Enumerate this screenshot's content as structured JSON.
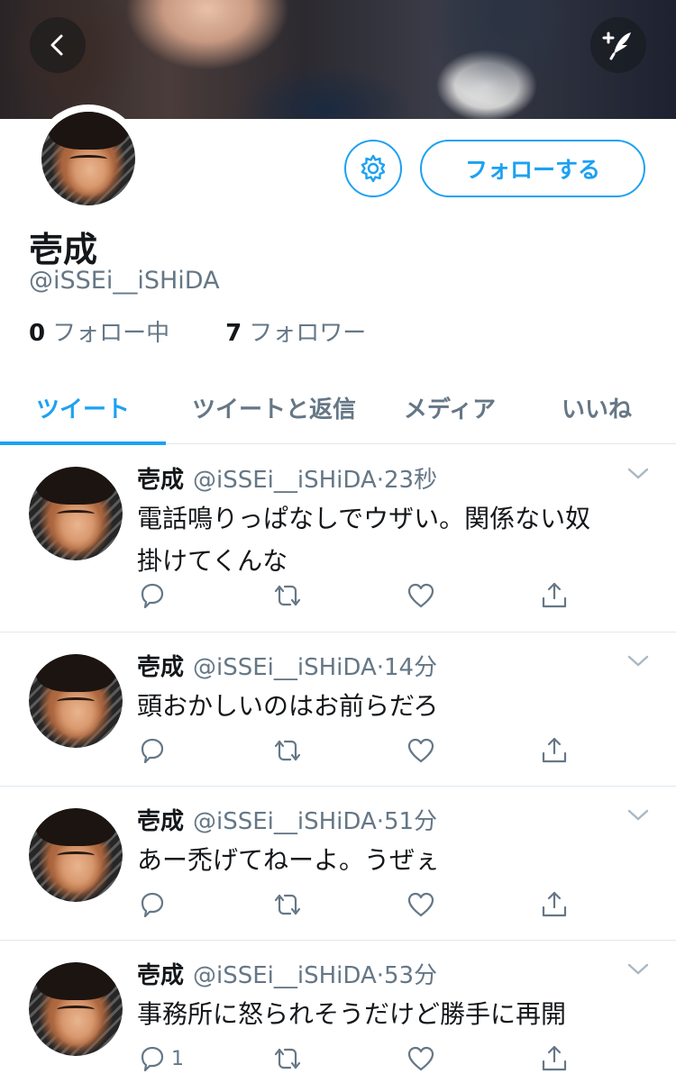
{
  "profile": {
    "display_name": "壱成",
    "handle": "@iSSEi__iSHiDA",
    "following_count": "0",
    "following_label": "フォロー中",
    "followers_count": "7",
    "followers_label": "フォロワー",
    "follow_button": "フォローする"
  },
  "tabs": [
    {
      "label": "ツイート",
      "active": true
    },
    {
      "label": "ツイートと返信",
      "active": false
    },
    {
      "label": "メディア",
      "active": false
    },
    {
      "label": "いいね",
      "active": false
    }
  ],
  "tweets": [
    {
      "name": "壱成",
      "handle": "@iSSEi__iSHiDA",
      "time": "23秒",
      "text_lines": [
        "電話鳴りっぱなしでウザい。関係ない奴",
        "掛けてくんな"
      ],
      "reply_count": ""
    },
    {
      "name": "壱成",
      "handle": "@iSSEi__iSHiDA",
      "time": "14分",
      "text_lines": [
        "頭おかしいのはお前らだろ"
      ],
      "reply_count": ""
    },
    {
      "name": "壱成",
      "handle": "@iSSEi__iSHiDA",
      "time": "51分",
      "text_lines": [
        "あー禿げてねーよ。うぜぇ"
      ],
      "reply_count": ""
    },
    {
      "name": "壱成",
      "handle": "@iSSEi__iSHiDA",
      "time": "53分",
      "text_lines": [
        "事務所に怒られそうだけど勝手に再開"
      ],
      "reply_count": "1"
    }
  ],
  "icons": {
    "back": "back-chevron-icon",
    "compose": "compose-tweet-icon",
    "settings": "gear-icon",
    "caret": "chevron-down-icon",
    "reply": "reply-bubble-icon",
    "retweet": "retweet-icon",
    "like": "heart-icon",
    "share": "share-icon"
  },
  "colors": {
    "accent": "#1da1f2",
    "secondary_text": "#657786",
    "divider": "#e1e8ed"
  }
}
